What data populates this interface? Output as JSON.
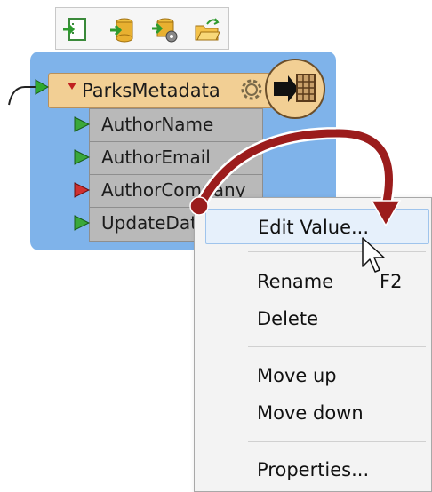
{
  "toolbar": {
    "icons": [
      "import-icon",
      "add-reader-icon",
      "add-reader-settings-icon",
      "open-folder-icon"
    ]
  },
  "transformer": {
    "title": "ParksMetadata",
    "attributes": [
      {
        "label": "AuthorName",
        "port_color": "#3aa83a"
      },
      {
        "label": "AuthorEmail",
        "port_color": "#3aa83a"
      },
      {
        "label": "AuthorCompany",
        "port_color": "#d03030"
      },
      {
        "label": "UpdateDate",
        "port_color": "#3aa83a"
      }
    ]
  },
  "context_menu": {
    "items": [
      {
        "label": "Edit Value...",
        "shortcut": "",
        "highlighted": true
      },
      {
        "label": "Rename",
        "shortcut": "F2",
        "highlighted": false
      },
      {
        "label": "Delete",
        "shortcut": "",
        "highlighted": false
      },
      {
        "label": "Move up",
        "shortcut": "",
        "highlighted": false
      },
      {
        "label": "Move down",
        "shortcut": "",
        "highlighted": false
      },
      {
        "label": "Properties...",
        "shortcut": "",
        "highlighted": false
      }
    ]
  },
  "colors": {
    "panel": "#7fb3ea",
    "header": "#f2cf94",
    "attribute_bg": "#b9b9b9",
    "annotation_arrow": "#9b1c1c",
    "menu_highlight": "#e6f0fb"
  }
}
